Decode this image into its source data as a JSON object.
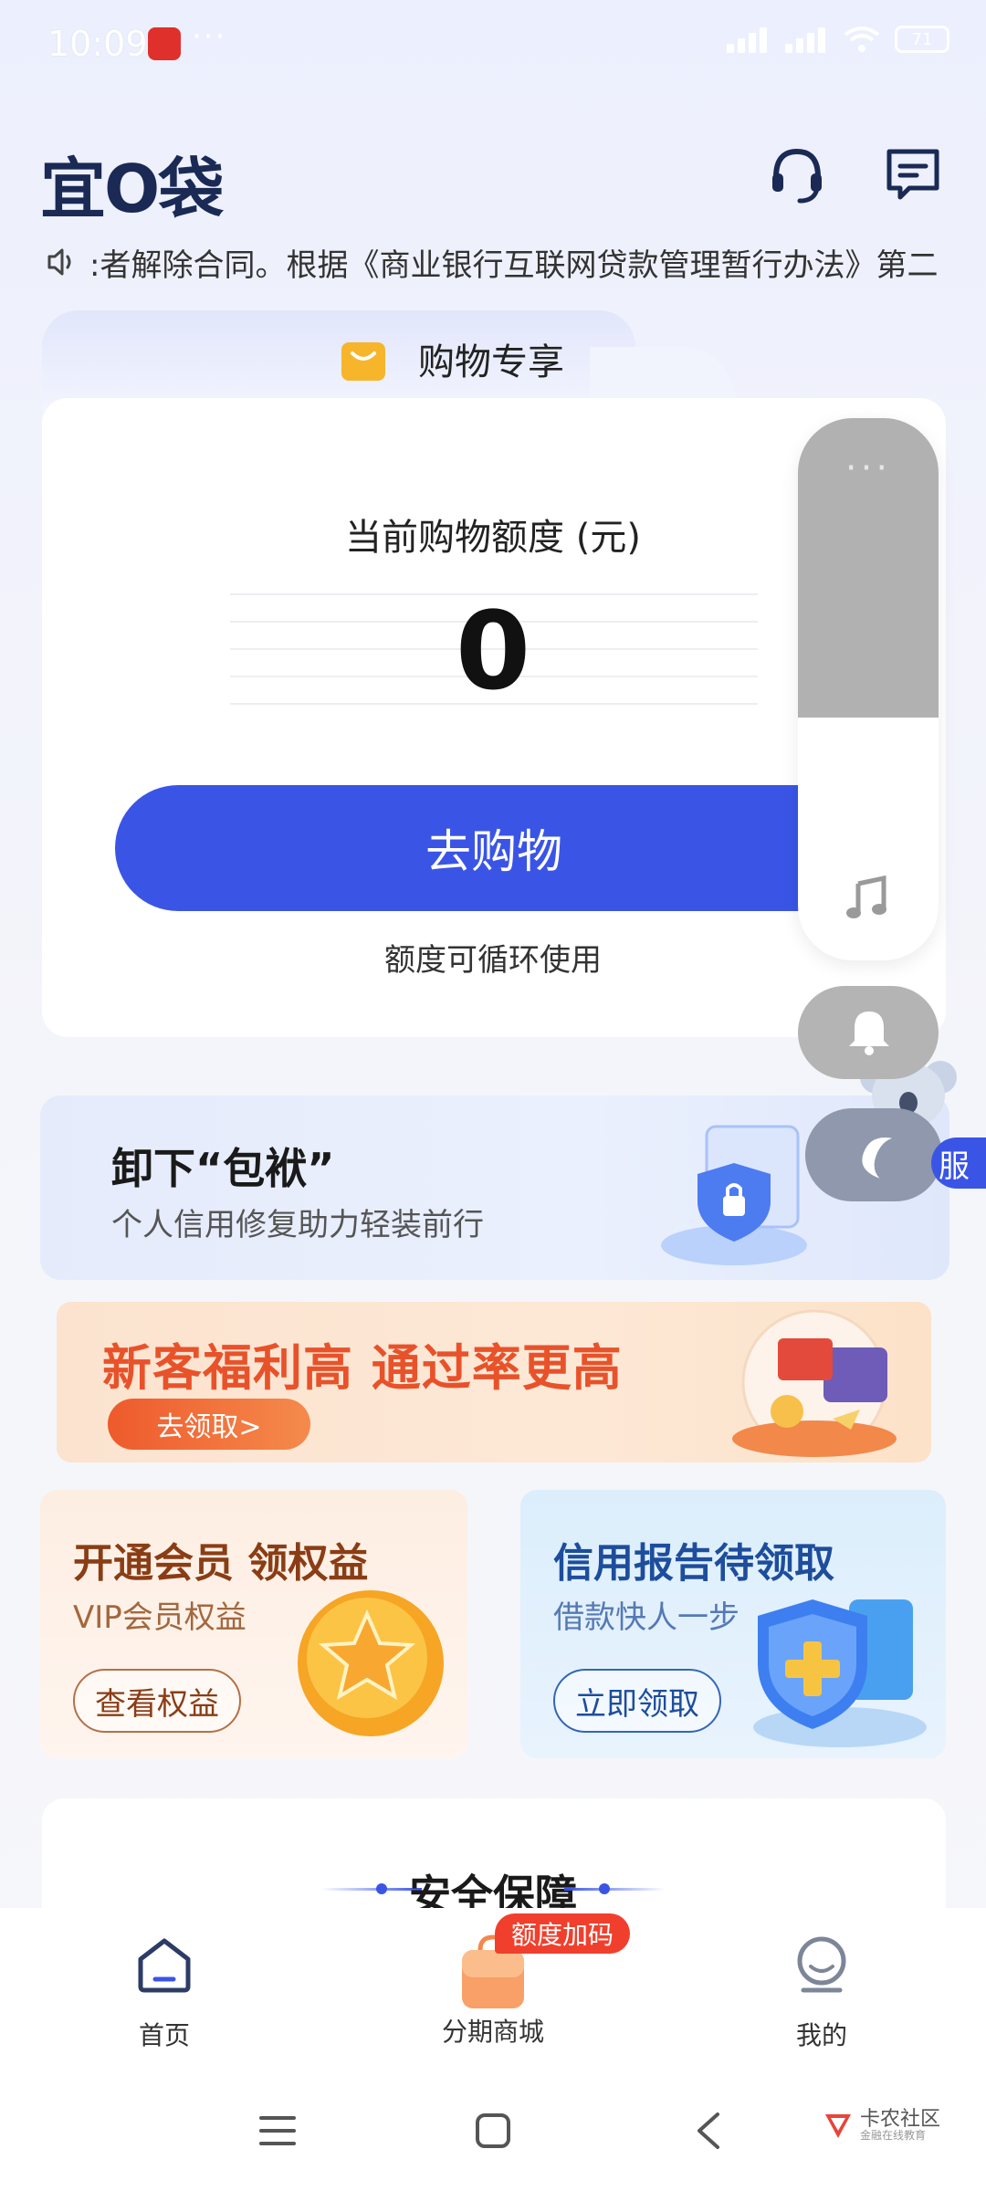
{
  "status_bar": {
    "time": "10:09",
    "dots": "···",
    "battery": "71"
  },
  "header": {
    "logo": "宜O袋",
    "icons": [
      "headset-icon",
      "message-icon"
    ]
  },
  "notice": {
    "text": ":者解除合同。根据《商业银行互联网贷款管理暂行办法》第二"
  },
  "card": {
    "tag": "购物专享",
    "limit_label": "当前购物额度 (元)",
    "amount": "0",
    "button": "去购物",
    "note": "额度可循环使用"
  },
  "float_panel": {
    "dots": "···",
    "service_tag": "服"
  },
  "banner1": {
    "title": "卸下“包袱”",
    "subtitle": "个人信用修复助力轻装前行"
  },
  "banner2": {
    "title": "新客福利高 通过率更高",
    "button": "去领取>"
  },
  "vip_card": {
    "title": "开通会员 领权益",
    "subtitle": "VIP会员权益",
    "button": "查看权益"
  },
  "credit_card": {
    "title": "信用报告待领取",
    "subtitle": "借款快人一步",
    "button": "立即领取"
  },
  "safety": {
    "title": "安全保障"
  },
  "bottom_nav": {
    "items": [
      {
        "label": "首页",
        "icon": "home-icon"
      },
      {
        "label": "分期商城",
        "icon": "shopping-bag-icon"
      },
      {
        "label": "我的",
        "icon": "profile-icon"
      }
    ],
    "badge": "额度加码"
  },
  "watermark": {
    "line1": "卡农社区",
    "line2": "金融在线教育"
  },
  "colors": {
    "primary": "#3a55e6",
    "badge": "#f0402d",
    "orange": "#e8522a"
  }
}
